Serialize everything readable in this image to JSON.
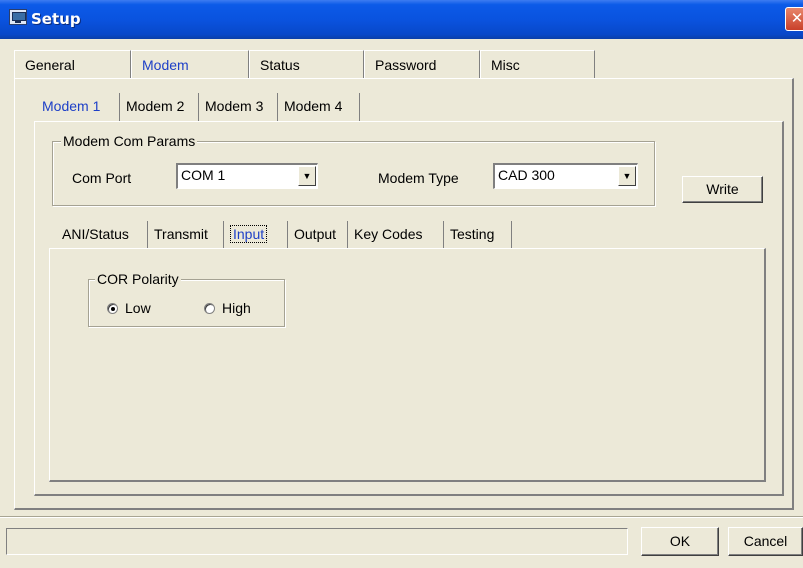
{
  "window": {
    "title": "Setup",
    "close_glyph": "✕"
  },
  "outer_tabs": [
    {
      "label": "General",
      "active": false
    },
    {
      "label": "Modem",
      "active": true
    },
    {
      "label": "Status",
      "active": false
    },
    {
      "label": "Password",
      "active": false
    },
    {
      "label": "Misc",
      "active": false
    }
  ],
  "modem_tabs": [
    {
      "label": "Modem 1",
      "active": true
    },
    {
      "label": "Modem 2",
      "active": false
    },
    {
      "label": "Modem 3",
      "active": false
    },
    {
      "label": "Modem 4",
      "active": false
    }
  ],
  "com_params": {
    "group_label": "Modem Com Params",
    "com_port_label": "Com Port",
    "com_port_value": "COM 1",
    "modem_type_label": "Modem Type",
    "modem_type_value": "CAD 300",
    "write_label": "Write"
  },
  "inner_tabs": [
    {
      "label": "ANI/Status",
      "active": false
    },
    {
      "label": "Transmit",
      "active": false
    },
    {
      "label": "Input",
      "active": true
    },
    {
      "label": "Output",
      "active": false
    },
    {
      "label": "Key Codes",
      "active": false
    },
    {
      "label": "Testing",
      "active": false
    }
  ],
  "cor_polarity": {
    "group_label": "COR Polarity",
    "low_label": "Low",
    "high_label": "High",
    "selected": "Low"
  },
  "footer": {
    "status_text": "",
    "ok_label": "OK",
    "cancel_label": "Cancel"
  },
  "icons": {
    "dropdown_arrow": "▼",
    "app_icon": "computer-icon"
  }
}
